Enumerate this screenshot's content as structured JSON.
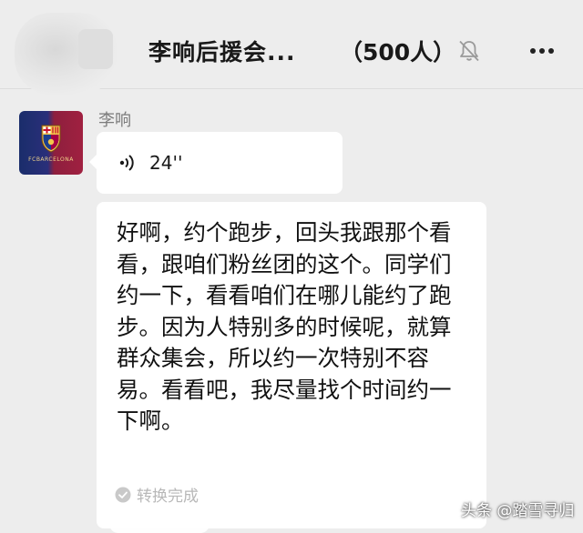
{
  "header": {
    "title": "李响后援会...",
    "member_count": "（500人）",
    "mute_icon": "bell-slash-icon",
    "more_icon": "more-dots-icon"
  },
  "message": {
    "sender_name": "李响",
    "avatar_icon": "fc-barcelona-crest",
    "avatar_text": "FCBARCELONA",
    "voice": {
      "icon": "voice-wave-icon",
      "duration": "24''"
    },
    "transcript": "好啊，约个跑步，回头我跟那个看看，跟咱们粉丝团的这个。同学们约一下，看看咱们在哪儿能约了跑步。因为人特别多的时候呢，就算群众集会，所以约一次特别不容易。看看吧，我尽量找个时间约一下啊。",
    "convert_status": "转换完成",
    "check_icon": "check-circle-icon"
  },
  "watermark": "头条 @踏雪寻归",
  "colors": {
    "background": "#ededed",
    "bubble": "#ffffff",
    "sender": "#7c7c7c",
    "status": "#b8b8b8"
  }
}
